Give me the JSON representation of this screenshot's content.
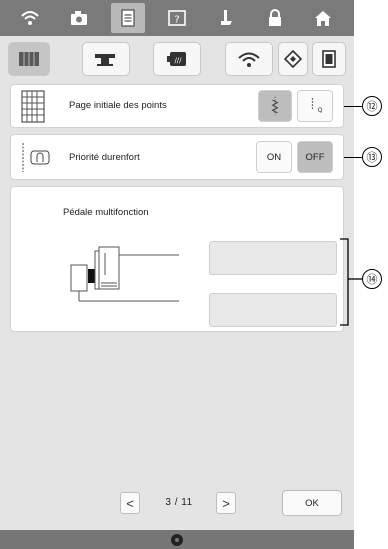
{
  "top_tabs": [
    {
      "icon": "wifi-icon"
    },
    {
      "icon": "camera-icon"
    },
    {
      "icon": "settings-page-icon",
      "active": true
    },
    {
      "icon": "help-icon"
    },
    {
      "icon": "sewing-foot-icon"
    },
    {
      "icon": "lock-icon"
    },
    {
      "icon": "home-icon"
    }
  ],
  "category_tabs": [
    {
      "icon": "sewing-settings-icon",
      "active": true
    },
    {
      "icon": "machine-settings-icon"
    },
    {
      "icon": "embroidery-frame-icon"
    },
    {
      "icon": "wireless-icon"
    },
    {
      "icon": "eco-icon"
    },
    {
      "icon": "screen-icon"
    }
  ],
  "settings": {
    "initial_stitch_page": {
      "label": "Page initiale des points",
      "callout": "⑫"
    },
    "heavyweight_priority": {
      "label": "Priorité durenfort",
      "on_label": "ON",
      "off_label": "OFF",
      "selected": "OFF",
      "callout": "⑬"
    },
    "multifunction_pedal": {
      "label": "Pédale multifonction",
      "callout": "⑭"
    }
  },
  "pagination": {
    "current": "3",
    "separator": "/",
    "total": "11",
    "prev": "<",
    "next": ">"
  },
  "ok_label": "OK",
  "colors": {
    "topbar": "#7a7a7a",
    "selected": "#bdbdbd",
    "panel": "#ffffff",
    "screen": "#e4e4e4"
  }
}
